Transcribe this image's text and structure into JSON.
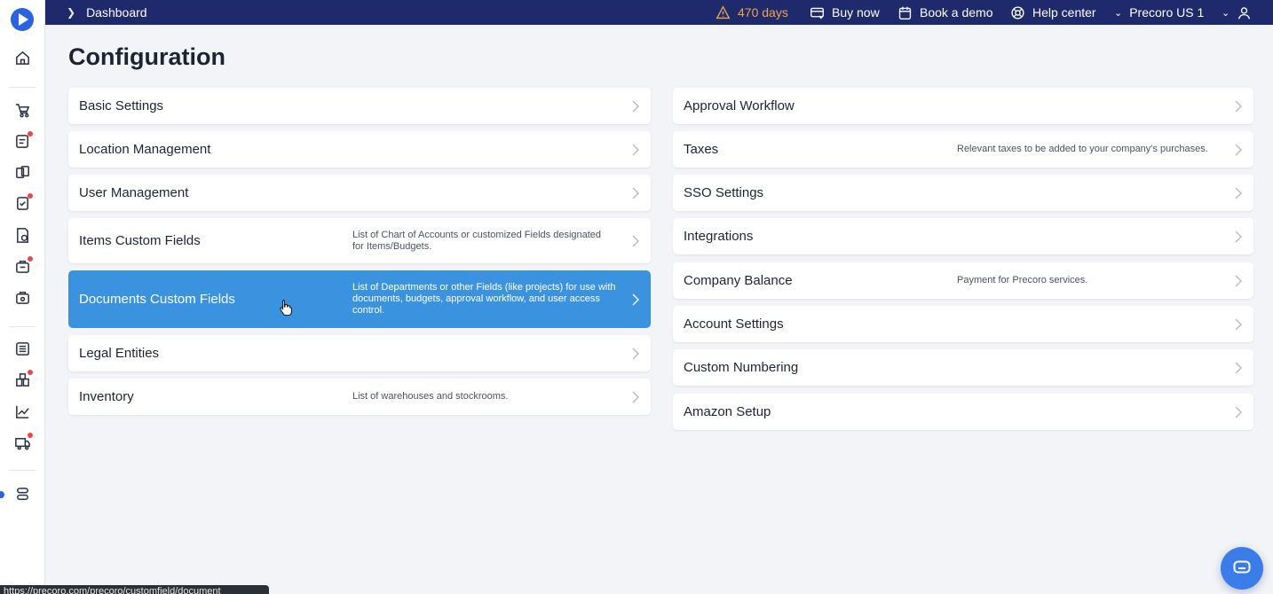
{
  "topbar": {
    "breadcrumb": "Dashboard",
    "trial": "470 days",
    "buy_now": "Buy now",
    "book_demo": "Book a demo",
    "help_center": "Help center",
    "company": "Precoro US 1"
  },
  "page": {
    "title": "Configuration"
  },
  "left_column": [
    {
      "label": "Basic Settings",
      "desc": ""
    },
    {
      "label": "Location Management",
      "desc": ""
    },
    {
      "label": "User Management",
      "desc": ""
    },
    {
      "label": "Items Custom Fields",
      "desc": "List of Chart of Accounts or customized Fields designated for Items/Budgets."
    },
    {
      "label": "Documents Custom Fields",
      "desc": "List of Departments or other Fields (like projects) for use with documents, budgets, approval workflow, and user access control."
    },
    {
      "label": "Legal Entities",
      "desc": ""
    },
    {
      "label": "Inventory",
      "desc": "List of warehouses and stockrooms."
    }
  ],
  "right_column": [
    {
      "label": "Approval Workflow",
      "desc": ""
    },
    {
      "label": "Taxes",
      "desc": "Relevant taxes to be added to your company's purchases."
    },
    {
      "label": "SSO Settings",
      "desc": ""
    },
    {
      "label": "Integrations",
      "desc": ""
    },
    {
      "label": "Company Balance",
      "desc": "Payment for Precoro services."
    },
    {
      "label": "Account Settings",
      "desc": ""
    },
    {
      "label": "Custom Numbering",
      "desc": ""
    },
    {
      "label": "Amazon Setup",
      "desc": ""
    }
  ],
  "status_bar": {
    "url": "https://precoro.com/precoro/customfield/document"
  },
  "colors": {
    "topbar": "#1e2a6b",
    "accent": "#2a62e0",
    "active_card": "#3b93e0",
    "warning": "#f0a44b"
  },
  "icons": {
    "sidebar": [
      "home-icon",
      "cart-icon",
      "request-icon",
      "team-icon",
      "approval-icon",
      "invoice-icon",
      "receipt-icon",
      "budget-icon",
      "reports-icon",
      "suppliers-icon",
      "analytics-icon",
      "delivery-icon",
      "settings-icon"
    ],
    "topbar": [
      "warning-icon",
      "card-icon",
      "calendar-icon",
      "lifebuoy-icon",
      "user-icon"
    ]
  }
}
